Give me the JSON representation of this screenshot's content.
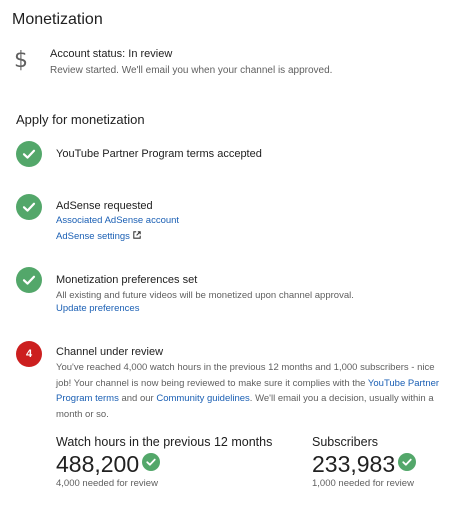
{
  "page": {
    "title": "Monetization"
  },
  "account_status": {
    "icon": "dollar-icon",
    "title": "Account status: In review",
    "subtitle": "Review started. We'll email you when your channel is approved."
  },
  "apply": {
    "title": "Apply for monetization",
    "steps": [
      {
        "icon": "check-icon",
        "title": "YouTube Partner Program terms accepted"
      },
      {
        "icon": "check-icon",
        "title": "AdSense requested",
        "links": [
          "Associated AdSense account",
          "AdSense settings"
        ],
        "ext_icon": "external-link-icon"
      },
      {
        "icon": "check-icon",
        "title": "Monetization preferences set",
        "description": "All existing and future videos will be monetized upon channel approval.",
        "links": [
          "Update preferences"
        ]
      },
      {
        "badge": "4",
        "title": "Channel under review",
        "description_parts": [
          "You've reached 4,000 watch hours in the previous 12 months and 1,000 subscribers - nice job! Your channel is now being reviewed to make sure it complies with the ",
          "YouTube Partner Program terms",
          " and our ",
          "Community guidelines",
          ". We'll email you a decision, usually within a month or so."
        ]
      }
    ]
  },
  "metrics": {
    "watch_hours": {
      "label": "Watch hours in the previous 12 months",
      "value": "488,200",
      "note": "4,000 needed for review"
    },
    "subscribers": {
      "label": "Subscribers",
      "value": "233,983",
      "note": "1,000 needed for review"
    }
  },
  "colors": {
    "success": "#53a76a",
    "alert": "#cc1f1f",
    "link": "#1a5fb4"
  }
}
